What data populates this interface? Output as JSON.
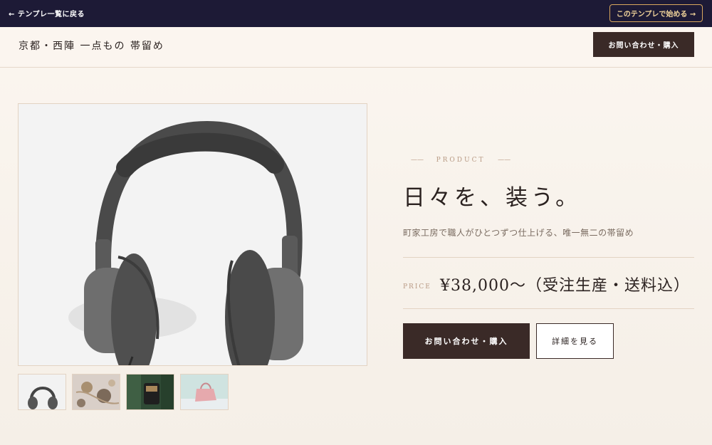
{
  "topbar": {
    "back_label": "← テンプレ一覧に戻る",
    "start_label": "このテンプレで始める →"
  },
  "header": {
    "brand": "京都・西陣 一点もの 帯留め",
    "cta_label": "お問い合わせ・購入"
  },
  "gallery": {
    "main_image": "headphones-photo",
    "thumbnails": [
      {
        "image": "headphones-photo"
      },
      {
        "image": "accessories-photo"
      },
      {
        "image": "backpack-photo"
      },
      {
        "image": "pink-bag-photo"
      }
    ]
  },
  "product": {
    "eyebrow": "PRODUCT",
    "headline": "日々を、装う。",
    "subtext": "町家工房で職人がひとつずつ仕上げる、唯一無二の帯留め",
    "price_label": "PRICE",
    "price": "¥38,000〜（受注生産・送料込）",
    "primary_cta": "お問い合わせ・購入",
    "secondary_cta": "詳細を見る"
  },
  "colors": {
    "topbar": "#1d1a36",
    "accent_gold": "#d9a75e",
    "button_dark": "#3a2a27",
    "background": "#fbf6f0"
  }
}
